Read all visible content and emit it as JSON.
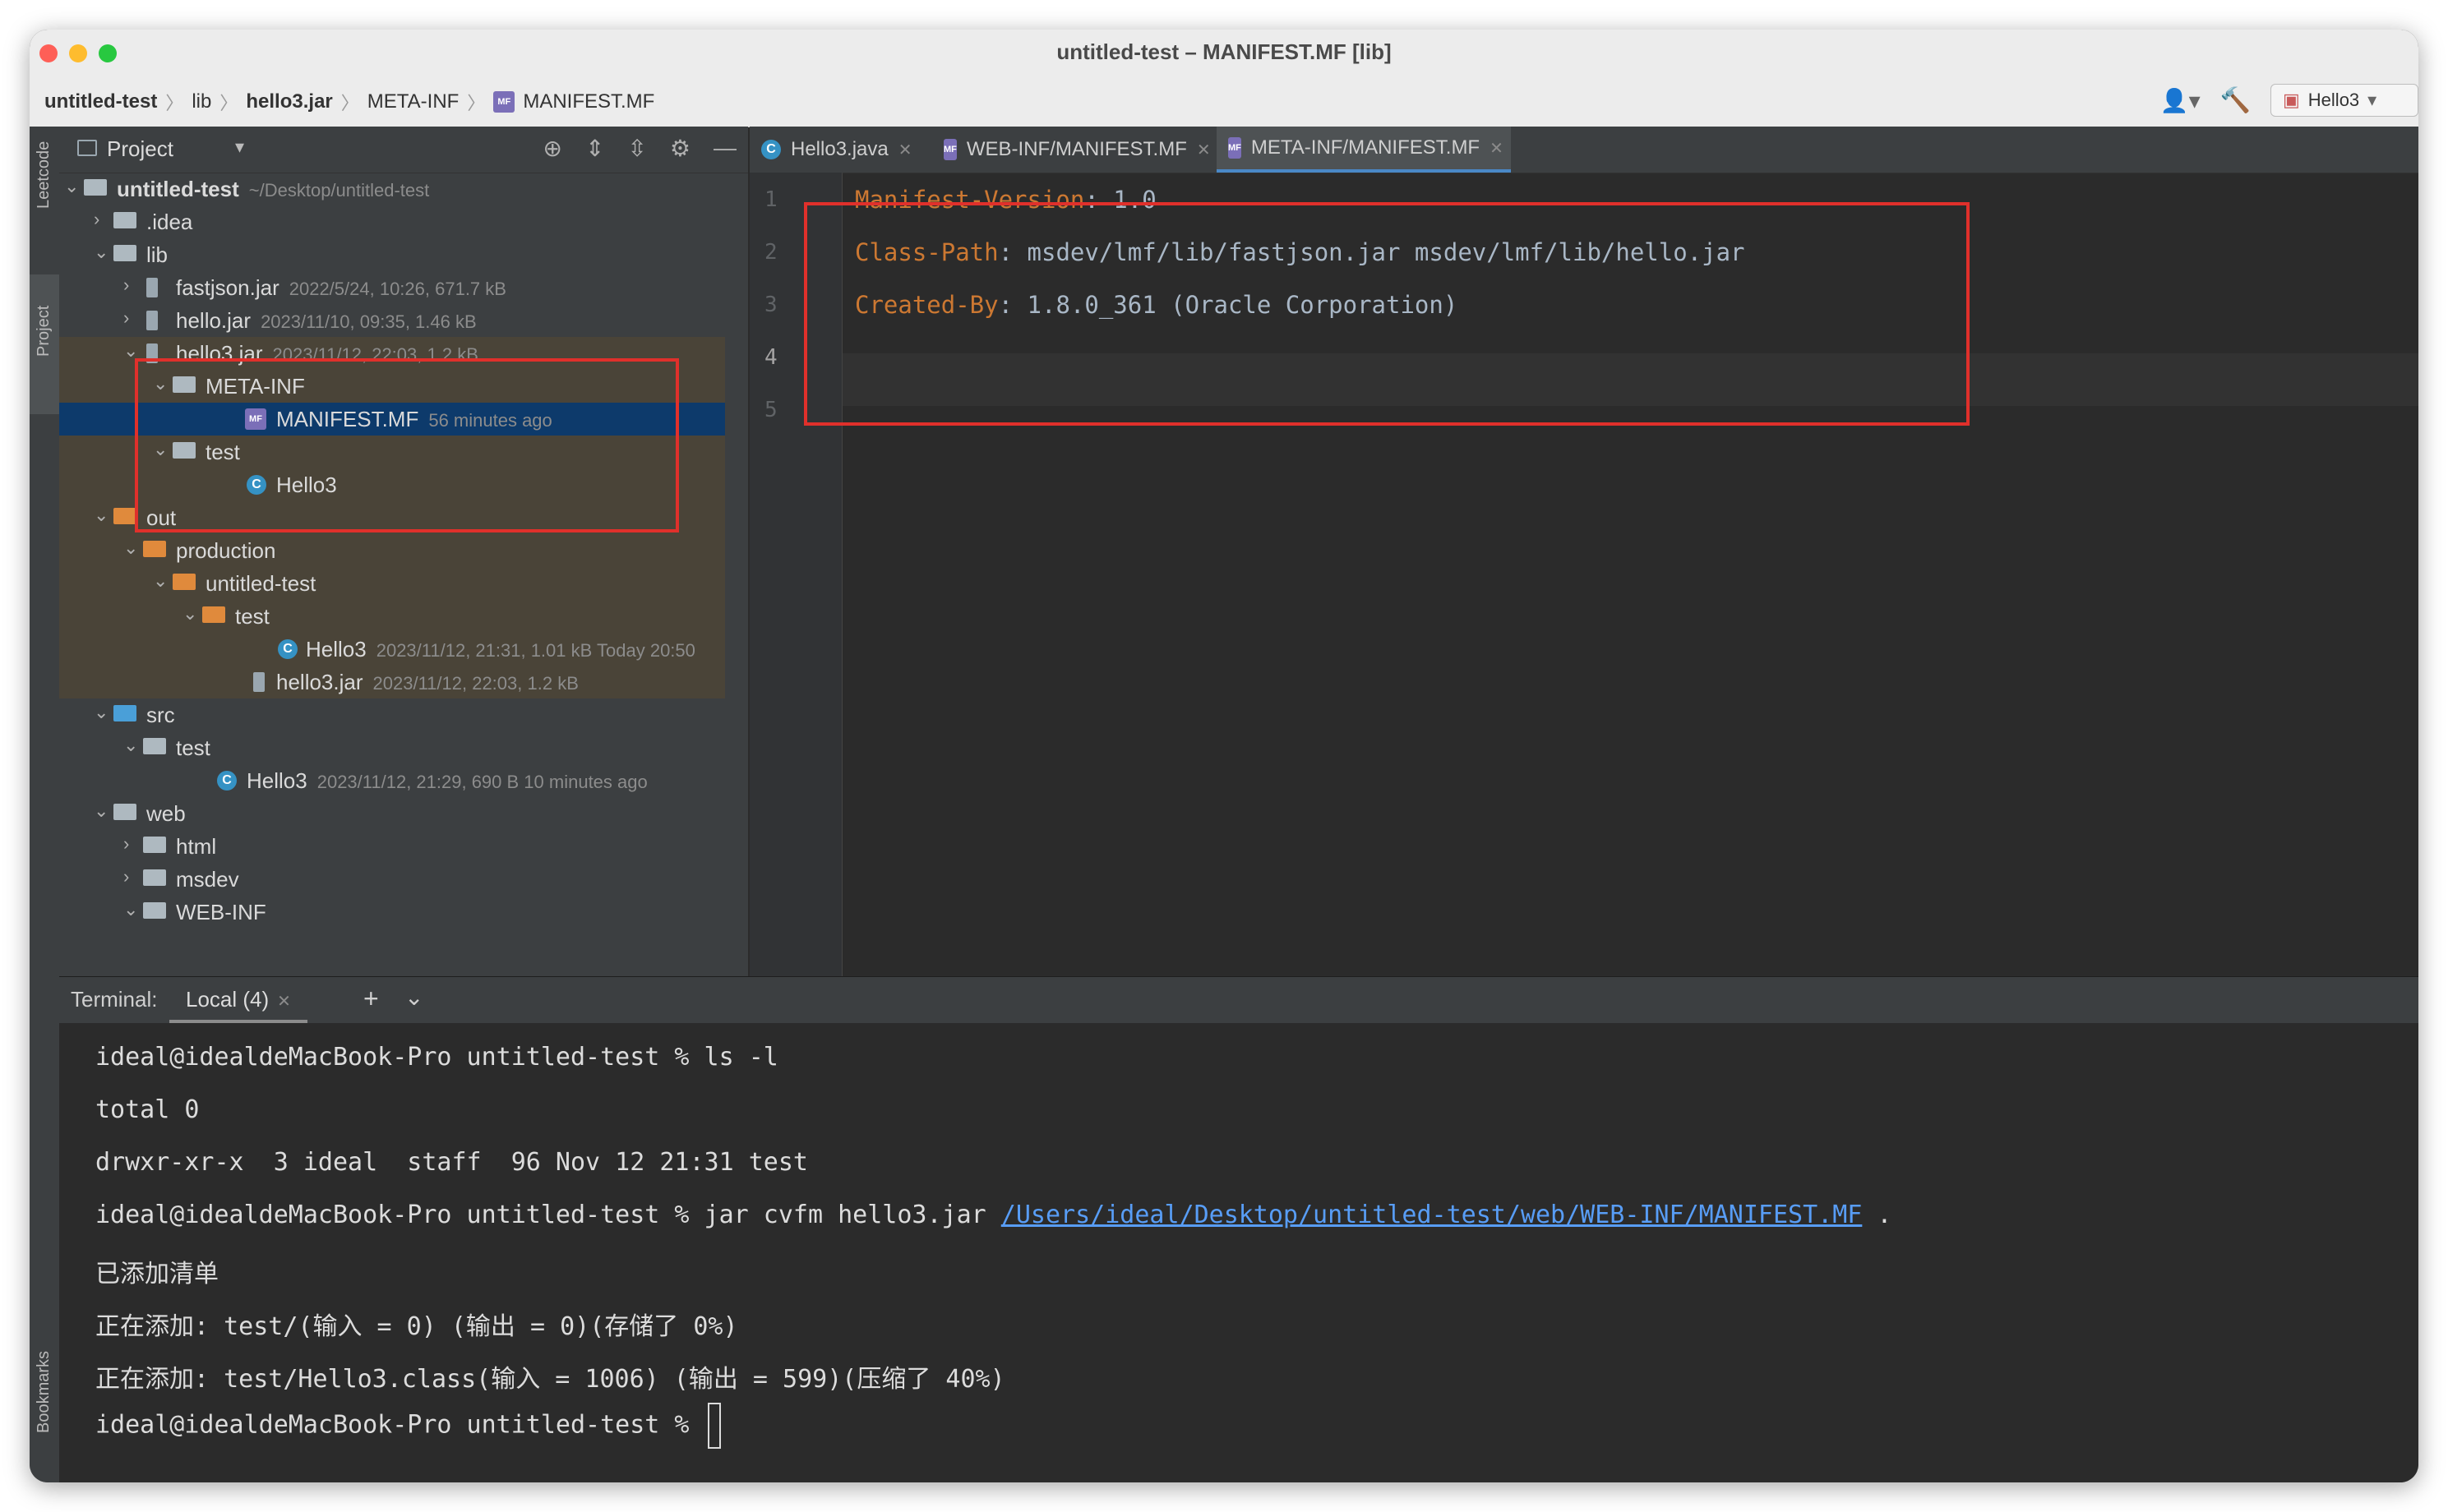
{
  "window": {
    "title": "untitled-test – MANIFEST.MF [lib]"
  },
  "breadcrumb": [
    "untitled-test",
    "lib",
    "hello3.jar",
    "META-INF",
    "MANIFEST.MF"
  ],
  "toolbar": {
    "run_config": "Hello3"
  },
  "side_strip": {
    "leetcode": "Leetcode",
    "project": "Project",
    "bookmarks": "Bookmarks"
  },
  "project_panel": {
    "title": "Project",
    "tree": [
      {
        "label": "untitled-test",
        "meta": "~/Desktop/untitled-test"
      },
      {
        "label": ".idea",
        "meta": ""
      },
      {
        "label": "lib",
        "meta": ""
      },
      {
        "label": "fastjson.jar",
        "meta": "2022/5/24, 10:26, 671.7 kB"
      },
      {
        "label": "hello.jar",
        "meta": "2023/11/10, 09:35, 1.46 kB"
      },
      {
        "label": "hello3.jar",
        "meta": "2023/11/12, 22:03, 1.2 kB"
      },
      {
        "label": "META-INF",
        "meta": ""
      },
      {
        "label": "MANIFEST.MF",
        "meta": "56 minutes ago"
      },
      {
        "label": "test",
        "meta": ""
      },
      {
        "label": "Hello3",
        "meta": ""
      },
      {
        "label": "out",
        "meta": ""
      },
      {
        "label": "production",
        "meta": ""
      },
      {
        "label": "untitled-test",
        "meta": ""
      },
      {
        "label": "test",
        "meta": ""
      },
      {
        "label": "Hello3",
        "meta": "2023/11/12, 21:31, 1.01 kB Today 20:50"
      },
      {
        "label": "hello3.jar",
        "meta": "2023/11/12, 22:03, 1.2 kB"
      },
      {
        "label": "src",
        "meta": ""
      },
      {
        "label": "test",
        "meta": ""
      },
      {
        "label": "Hello3",
        "meta": "2023/11/12, 21:29, 690 B 10 minutes ago"
      },
      {
        "label": "web",
        "meta": ""
      },
      {
        "label": "html",
        "meta": ""
      },
      {
        "label": "msdev",
        "meta": ""
      },
      {
        "label": "WEB-INF",
        "meta": ""
      }
    ]
  },
  "editor": {
    "tabs": [
      {
        "label": "Hello3.java",
        "icon": "C"
      },
      {
        "label": "WEB-INF/MANIFEST.MF",
        "icon": "MF"
      },
      {
        "label": "META-INF/MANIFEST.MF",
        "icon": "MF"
      }
    ],
    "line_numbers": [
      "1",
      "2",
      "3",
      "4",
      "5"
    ],
    "lines": [
      {
        "key": "Manifest-Version",
        "value": ": 1.0"
      },
      {
        "key": "Class-Path",
        "value": ": msdev/lmf/lib/fastjson.jar msdev/lmf/lib/hello.jar"
      },
      {
        "key": "Created-By",
        "value": ": 1.8.0_361 (Oracle Corporation)"
      }
    ]
  },
  "terminal": {
    "label": "Terminal:",
    "tab": "Local (4)",
    "lines": [
      "ideal@idealdeMacBook-Pro untitled-test % ls -l",
      "total 0",
      "drwxr-xr-x  3 ideal  staff  96 Nov 12 21:31 test",
      "ideal@idealdeMacBook-Pro untitled-test % jar cvfm hello3.jar ",
      "已添加清单",
      "正在添加: test/(输入 = 0) (输出 = 0)(存储了 0%)",
      "正在添加: test/Hello3.class(输入 = 1006) (输出 = 599)(压缩了 40%)",
      "ideal@idealdeMacBook-Pro untitled-test % "
    ],
    "link": "/Users/ideal/Desktop/untitled-test/web/WEB-INF/MANIFEST.MF",
    "link_suffix": " ."
  },
  "colors": {
    "annotation": "#e0302b",
    "key": "#cc7832",
    "selection": "#0d3a6b"
  }
}
